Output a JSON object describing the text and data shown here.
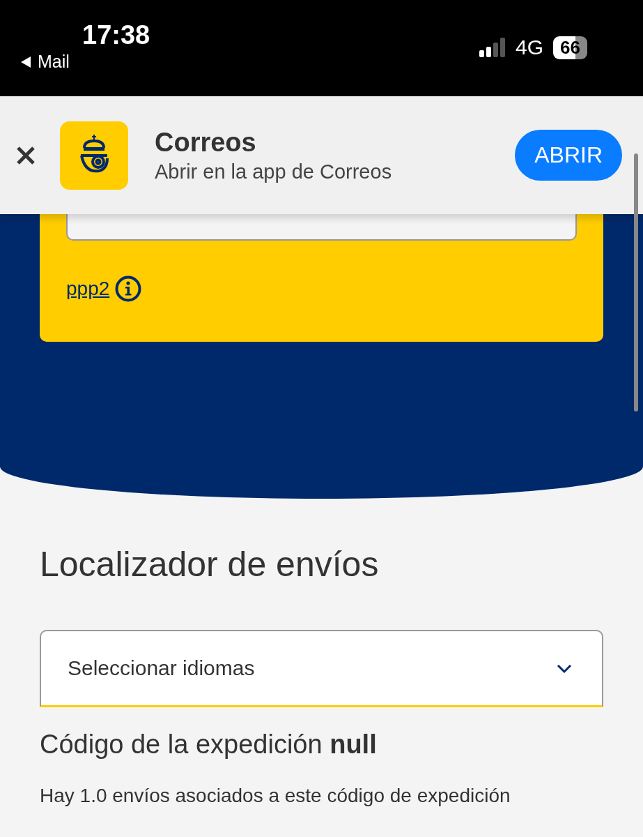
{
  "status_bar": {
    "time": "17:38",
    "back_label": "Mail",
    "network": "4G",
    "battery": "66"
  },
  "app_banner": {
    "app_name": "Correos",
    "subtitle": "Abrir en la app de Correos",
    "button": "ABRIR"
  },
  "card": {
    "link": "ppp2"
  },
  "title": "Localizador de envíos",
  "language_select": {
    "label": "Seleccionar idiomas"
  },
  "expedition": {
    "heading": "Código de la expedición **null**",
    "text": "Hay 1.0 envíos asociados a este código de expedición"
  }
}
